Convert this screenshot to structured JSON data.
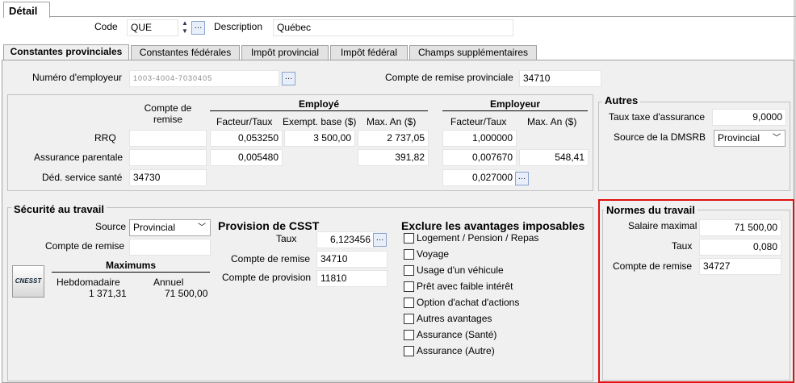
{
  "tabs": {
    "detail": "Détail"
  },
  "header": {
    "code_label": "Code",
    "code_value": "QUE",
    "desc_label": "Description",
    "desc_value": "Québec"
  },
  "subtabs": [
    "Constantes provinciales",
    "Constantes fédérales",
    "Impôt provincial",
    "Impôt fédéral",
    "Champs supplémentaires"
  ],
  "employer": {
    "num_label": "Numéro d'employeur",
    "num_value": "1003-4004-7030405",
    "remit_label": "Compte de remise provinciale",
    "remit_value": "34710"
  },
  "contrib": {
    "col_compte": "Compte de remise",
    "employe": "Employé",
    "employeur": "Employeur",
    "h_facteur": "Facteur/Taux",
    "h_exempt": "Exempt. base ($)",
    "h_max": "Max. An ($)",
    "h_facteur2": "Facteur/Taux",
    "h_max2": "Max. An ($)",
    "rrq": "RRQ",
    "rrq_facteur": "0,053250",
    "rrq_exempt": "3 500,00",
    "rrq_max": "2 737,05",
    "rrq_facteur2": "1,000000",
    "ap": "Assurance parentale",
    "ap_facteur": "0,005480",
    "ap_max": "391,82",
    "ap_facteur2": "0,007670",
    "ap_max2": "548,41",
    "dss": "Déd. service santé",
    "dss_compte": "34730",
    "dss_facteur2": "0,027000"
  },
  "autres": {
    "title": "Autres",
    "taux_label": "Taux taxe d'assurance",
    "taux_value": "9,0000",
    "source_label": "Source de la DMSRB",
    "source_value": "Provincial"
  },
  "securite": {
    "title": "Sécurité au travail",
    "source_label": "Source",
    "source_value": "Provincial",
    "remit_label": "Compte de remise",
    "maximums": "Maximums",
    "hebdo_label": "Hebdomadaire",
    "hebdo_value": "1 371,31",
    "annuel_label": "Annuel",
    "annuel_value": "71 500,00",
    "logo": "CNESST"
  },
  "csst": {
    "title": "Provision de CSST",
    "taux_label": "Taux",
    "taux_value": "6,123456",
    "remit_label": "Compte de remise",
    "remit_value": "34710",
    "prov_label": "Compte de provision",
    "prov_value": "11810"
  },
  "exclure": {
    "title": "Exclure les avantages imposables",
    "items": [
      "Logement / Pension / Repas",
      "Voyage",
      "Usage d'un véhicule",
      "Prêt avec faible intérêt",
      "Option d'achat d'actions",
      "Autres avantages",
      "Assurance (Santé)",
      "Assurance (Autre)"
    ]
  },
  "normes": {
    "title": "Normes du travail",
    "salaire_label": "Salaire maximal",
    "salaire_value": "71 500,00",
    "taux_label": "Taux",
    "taux_value": "0,080",
    "remit_label": "Compte de remise",
    "remit_value": "34727"
  },
  "colors": {
    "highlight": "#e01010",
    "panel": "#f0f0f0"
  }
}
